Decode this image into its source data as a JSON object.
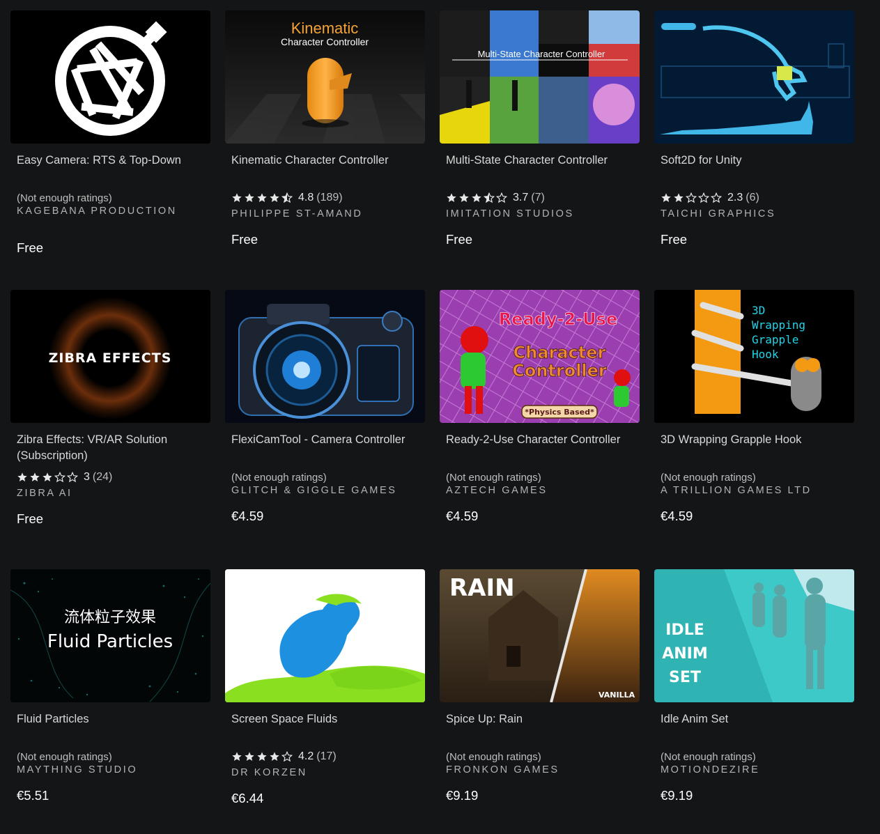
{
  "products": [
    {
      "title": "Easy Camera: RTS & Top-Down",
      "rating_text": "(Not enough ratings)",
      "publisher": "KAGEBANA PRODUCTION",
      "price": "Free",
      "art": "camera-shutter-art"
    },
    {
      "title": "Kinematic Character Controller",
      "score": "4.8",
      "count": "(189)",
      "stars": 4.8,
      "publisher": "PHILIPPE ST-AMAND",
      "price": "Free",
      "art_title": "Kinematic",
      "art_subtitle": "Character Controller"
    },
    {
      "title": "Multi-State Character Controller",
      "score": "3.7",
      "count": "(7)",
      "stars": 3.7,
      "publisher": "IMITATION STUDIOS",
      "price": "Free",
      "art_title": "Multi-State Character Controller"
    },
    {
      "title": "Soft2D for Unity",
      "score": "2.3",
      "count": "(6)",
      "stars": 2.3,
      "publisher": "TAICHI GRAPHICS",
      "price": "Free"
    },
    {
      "title": "Zibra Effects: VR/AR Solution (Subscription)",
      "score": "3",
      "count": "(24)",
      "stars": 3,
      "publisher": "ZIBRA AI",
      "price": "Free",
      "art_title": "ZIBRA EFFECTS"
    },
    {
      "title": "FlexiCamTool - Camera Controller",
      "rating_text": "(Not enough ratings)",
      "publisher": "GLITCH & GIGGLE GAMES",
      "price": "€4.59"
    },
    {
      "title": "Ready-2-Use Character Controller",
      "rating_text": "(Not enough ratings)",
      "publisher": "AZTECH GAMES",
      "price": "€4.59",
      "art_title": "Ready-2-Use",
      "art_subtitle": "Character",
      "art_subtitle2": "Controller",
      "art_badge": "*Physics Based*"
    },
    {
      "title": "3D Wrapping Grapple Hook",
      "rating_text": "(Not enough ratings)",
      "publisher": "A TRILLION GAMES LTD",
      "price": "€4.59",
      "art_lines": [
        "3D",
        "Wrapping",
        "Grapple",
        "Hook"
      ]
    },
    {
      "title": "Fluid Particles",
      "rating_text": "(Not enough ratings)",
      "publisher": "MAYTHING STUDIO",
      "price": "€5.51",
      "art_title": "流体粒子效果",
      "art_subtitle": "Fluid Particles"
    },
    {
      "title": "Screen Space Fluids",
      "score": "4.2",
      "count": "(17)",
      "stars": 4.2,
      "publisher": "DR KORZEN",
      "price": "€6.44"
    },
    {
      "title": "Spice Up: Rain",
      "rating_text": "(Not enough ratings)",
      "publisher": "FRONKON GAMES",
      "price": "€9.19",
      "art_title": "RAIN",
      "art_subtitle": "VANILLA"
    },
    {
      "title": "Idle Anim Set",
      "rating_text": "(Not enough ratings)",
      "publisher": "MOTIONDEZIRE",
      "price": "€9.19",
      "art_lines": [
        "IDLE",
        "ANIM",
        "SET"
      ]
    }
  ],
  "colors": {
    "background": "#141517",
    "star": "#e8e8e8",
    "price": "#ffffff"
  }
}
